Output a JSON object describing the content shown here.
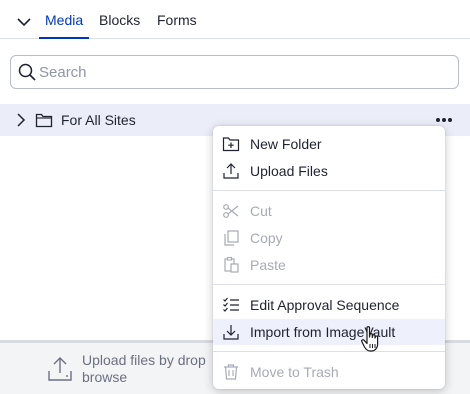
{
  "tabs": [
    {
      "label": "Media",
      "active": true
    },
    {
      "label": "Blocks",
      "active": false
    },
    {
      "label": "Forms",
      "active": false
    }
  ],
  "search": {
    "placeholder": "Search",
    "value": ""
  },
  "tree": {
    "root_label": "For All Sites"
  },
  "upload_area": {
    "line1": "Upload files by drop",
    "line2": "browse"
  },
  "context_menu": {
    "new_folder": "New Folder",
    "upload_files": "Upload Files",
    "cut": "Cut",
    "copy": "Copy",
    "paste": "Paste",
    "edit_approval": "Edit Approval Sequence",
    "import_imagevault": "Import from ImageVault",
    "move_to_trash": "Move to Trash"
  },
  "colors": {
    "accent": "#0037c1",
    "selected_row": "#ebeef8",
    "disabled_text": "#a7abb5"
  }
}
